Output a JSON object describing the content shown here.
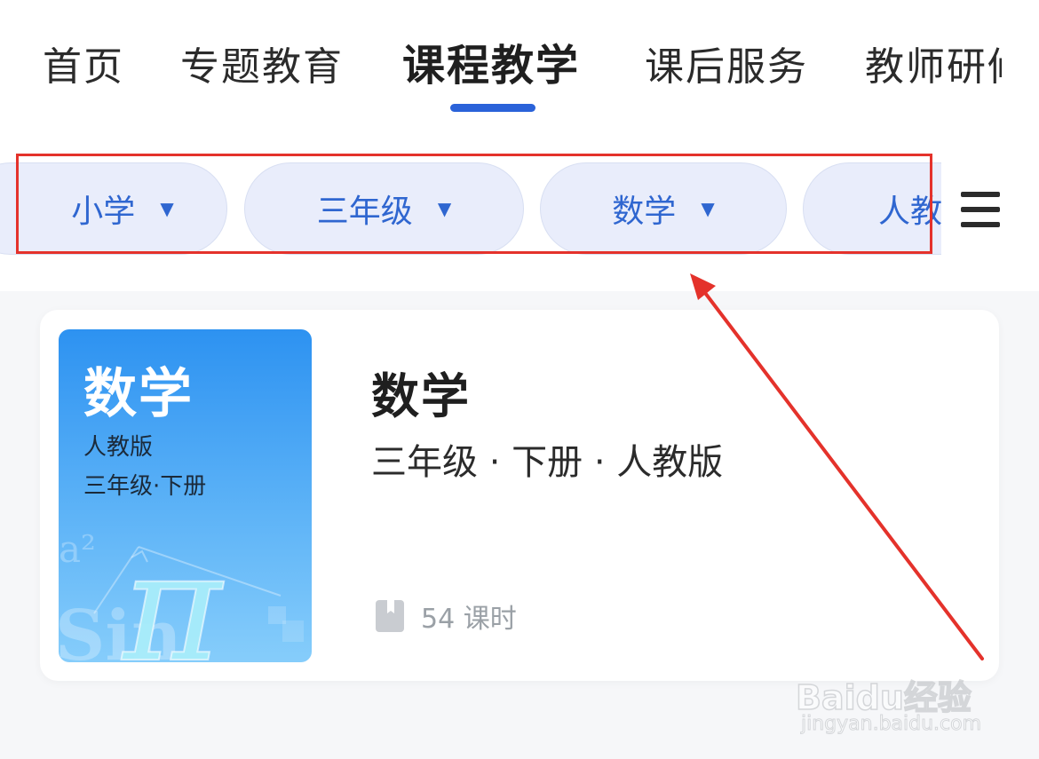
{
  "tabs": [
    {
      "label": "首页",
      "active": false
    },
    {
      "label": "专题教育",
      "active": false
    },
    {
      "label": "课程教学",
      "active": true
    },
    {
      "label": "课后服务",
      "active": false
    },
    {
      "label": "教师研修",
      "active": false
    }
  ],
  "filters": [
    {
      "label": "小学",
      "caret": "▼"
    },
    {
      "label": "三年级",
      "caret": "▼"
    },
    {
      "label": "数学",
      "caret": "▼"
    },
    {
      "label": "人教版",
      "caret": ""
    }
  ],
  "course": {
    "cover_title": "数学",
    "cover_edition": "人教版",
    "cover_grade": "三年级·下册",
    "title": "数学",
    "subtitle": "三年级 · 下册 · 人教版",
    "lessons": "54 课时"
  },
  "watermark": {
    "brand": "Baidu经验",
    "url": "jingyan.baidu.com"
  },
  "colors": {
    "accent": "#2a62d9",
    "chip_bg": "#e9edfb",
    "chip_text": "#2f66d0",
    "annotation": "#e4322b"
  },
  "icons": {
    "menu": "menu-icon",
    "lesson": "book-icon",
    "dropdown": "caret-down-icon"
  }
}
